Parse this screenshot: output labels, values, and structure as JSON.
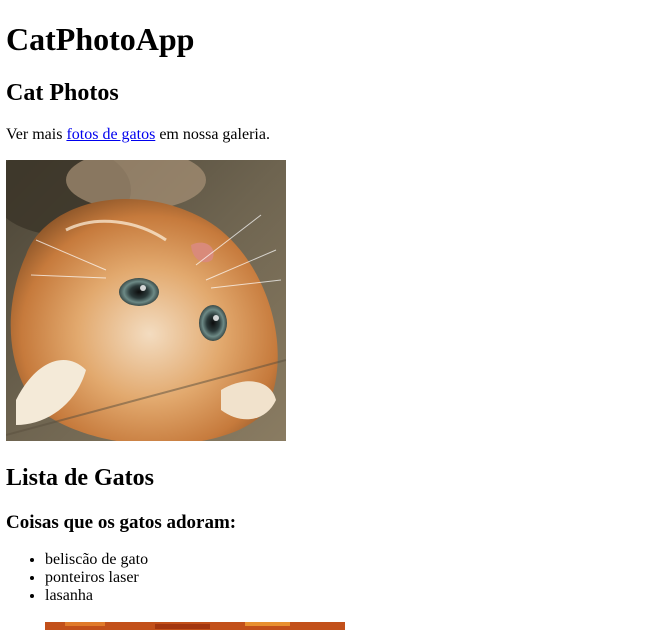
{
  "header": {
    "title": "CatPhotoApp"
  },
  "photos_section": {
    "heading": "Cat Photos",
    "gallery_prefix": "Ver mais ",
    "gallery_link": "fotos de gatos",
    "gallery_suffix": " em nossa galeria."
  },
  "list_section": {
    "heading": "Lista de Gatos",
    "subheading": "Coisas que os gatos adoram:",
    "items": [
      "beliscão de gato",
      "ponteiros laser",
      "lasanha"
    ]
  },
  "images": {
    "main_photo": "kitten-photo",
    "second_photo": "lasagna-photo"
  },
  "colors": {
    "link": "#0000ee",
    "text": "#000000",
    "background": "#ffffff"
  }
}
